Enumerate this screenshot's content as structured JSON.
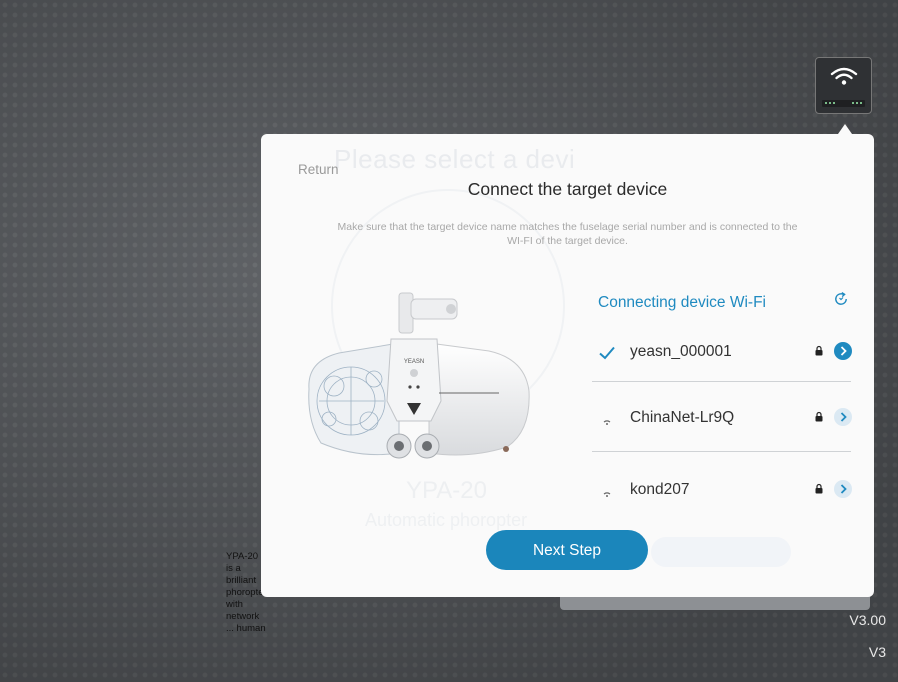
{
  "background": {
    "description_text": "YPA-20 is a brilliant phoropter with network ... human",
    "version_top": "V3.00",
    "version_bottom": "V3"
  },
  "modal": {
    "ghost_title": "Please select a devi",
    "ghost_model": "YPA-20",
    "ghost_subtitle": "Automatic phoropter",
    "return_label": "Return",
    "title": "Connect the target device",
    "subtitle": "Make sure that the target device name matches the fuselage serial number and is connected to the WI-FI of the target device.",
    "wifi_header": "Connecting device Wi-Fi",
    "networks": [
      {
        "ssid": "yeasn_000001",
        "connected": true,
        "locked": true
      },
      {
        "ssid": "ChinaNet-Lr9Q",
        "connected": false,
        "locked": true
      },
      {
        "ssid": "kond207",
        "connected": false,
        "locked": true
      }
    ],
    "device_brand": "YEASN",
    "next_button": "Next Step"
  },
  "colors": {
    "accent": "#1b86bb",
    "background": "#56595d",
    "modal": "#fafafa"
  }
}
